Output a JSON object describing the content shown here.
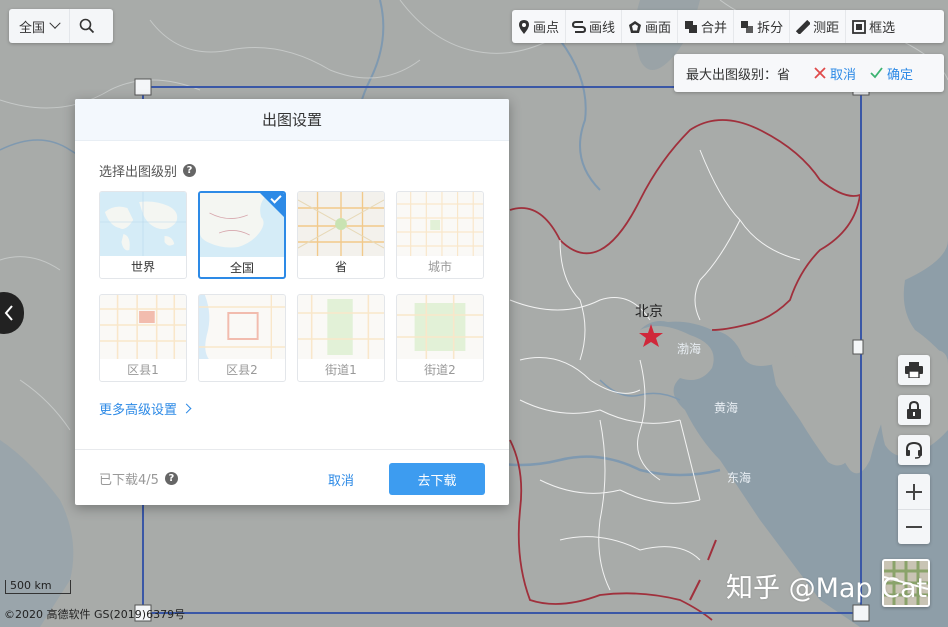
{
  "search": {
    "region": "全国"
  },
  "toolbar": {
    "tools": [
      {
        "label": "画点",
        "icon": "pin-icon"
      },
      {
        "label": "画线",
        "icon": "line-icon"
      },
      {
        "label": "画面",
        "icon": "polygon-icon"
      },
      {
        "label": "合并",
        "icon": "merge-icon"
      },
      {
        "label": "拆分",
        "icon": "split-icon"
      },
      {
        "label": "测距",
        "icon": "ruler-icon"
      },
      {
        "label": "框选",
        "icon": "box-select-icon"
      }
    ]
  },
  "level_bar": {
    "label": "最大出图级别：省",
    "cancel": "取消",
    "confirm": "确定"
  },
  "map": {
    "labels": {
      "capital": "北京",
      "bohai": "渤海",
      "yellow_sea": "黄海",
      "east_sea": "东海"
    },
    "scale": "500 km",
    "copyright": "©2020 高德软件 GS(2019)6379号"
  },
  "watermark": "知乎 @Map Cat",
  "modal": {
    "title": "出图设置",
    "section_title": "选择出图级别",
    "levels": [
      {
        "label": "世界",
        "state": "normal"
      },
      {
        "label": "全国",
        "state": "selected"
      },
      {
        "label": "省",
        "state": "normal"
      },
      {
        "label": "城市",
        "state": "disabled"
      },
      {
        "label": "区县1",
        "state": "disabled"
      },
      {
        "label": "区县2",
        "state": "disabled"
      },
      {
        "label": "街道1",
        "state": "disabled"
      },
      {
        "label": "街道2",
        "state": "disabled"
      }
    ],
    "more_settings": "更多高级设置",
    "downloaded": "已下载4/5",
    "cancel": "取消",
    "download": "去下载"
  },
  "colors": {
    "accent": "#2d8ae6",
    "primary_button": "#3d9cf0",
    "sea": "#8e9ea8",
    "land": "#a8aba9",
    "border": "#a0303c",
    "capital_star": "#d0283a"
  }
}
